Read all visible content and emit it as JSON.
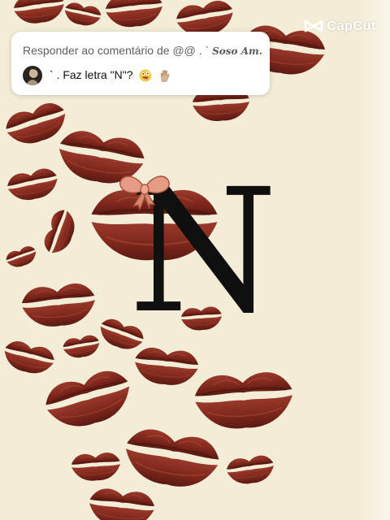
{
  "reply_card": {
    "header": "Responder ao comentário de @@ . ` ",
    "username": "Soso Am...",
    "comment": "` . Faz letra \"N\"?"
  },
  "emojis": [
    "zany-face-icon",
    "raised-hand-icon"
  ],
  "watermark": {
    "label": "CapCut"
  },
  "monogram": {
    "letter": "N"
  },
  "colors": {
    "background": "#f3ecd6",
    "lip_red": "#8a2e22",
    "lip_dark": "#5a1a12",
    "bow_pink": "#e59b84",
    "letter": "#0f0f0f"
  }
}
